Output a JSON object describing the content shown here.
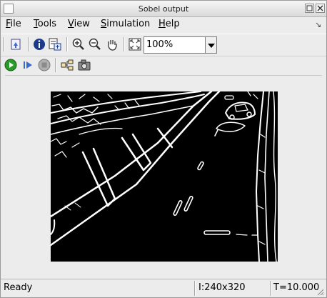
{
  "window": {
    "title": "Sobel output"
  },
  "menu": {
    "items": [
      {
        "label": "File"
      },
      {
        "label": "Tools"
      },
      {
        "label": "View"
      },
      {
        "label": "Simulation"
      },
      {
        "label": "Help"
      }
    ]
  },
  "toolbar": {
    "zoom_value": "100%",
    "icons": [
      "go-to-parent-icon",
      "info-icon",
      "properties-icon",
      "zoom-in-icon",
      "zoom-out-icon",
      "pan-hand-icon",
      "fit-to-view-icon"
    ]
  },
  "toolbar2": {
    "icons": [
      "run-icon",
      "step-forward-icon",
      "stop-icon",
      "highlight-block-icon",
      "snapshot-camera-icon"
    ]
  },
  "status": {
    "state": "Ready",
    "dims": "I:240x320",
    "time": "T=10.000"
  },
  "colors": {
    "run_green": "#2a9a2a",
    "step_blue": "#3a6acc",
    "stop_gray": "#8a8a8a",
    "video_bg": "#000000",
    "edge": "#ffffff"
  }
}
